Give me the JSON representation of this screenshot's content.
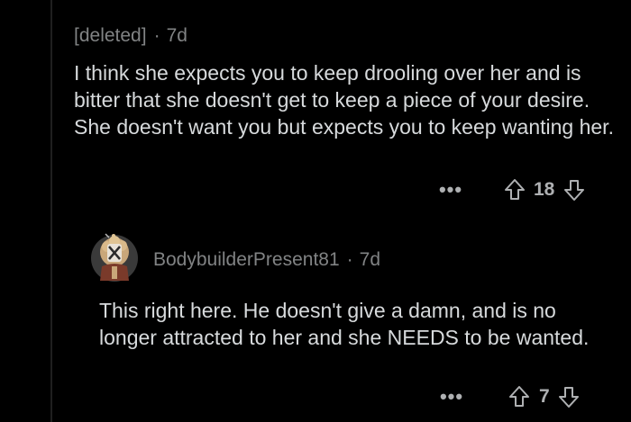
{
  "comment": {
    "author": "[deleted]",
    "separator": "·",
    "age": "7d",
    "text": "I think she expects you to keep drooling over her and is bitter that she doesn't get to keep a piece of your desire. She doesn't want you but expects you to keep wanting her.",
    "more_label": "•••",
    "score": "18"
  },
  "reply": {
    "author": "BodybuilderPresent81",
    "separator": "·",
    "age": "7d",
    "text": "This right here. He doesn't give a damn, and is no longer attracted to her and she NEEDS to be wanted.",
    "more_label": "•••",
    "score": "7"
  },
  "colors": {
    "background": "#000000",
    "text": "#d7dadc",
    "meta": "#818384",
    "icon": "#aeb0b2",
    "thread_line": "#1f1f1f"
  }
}
